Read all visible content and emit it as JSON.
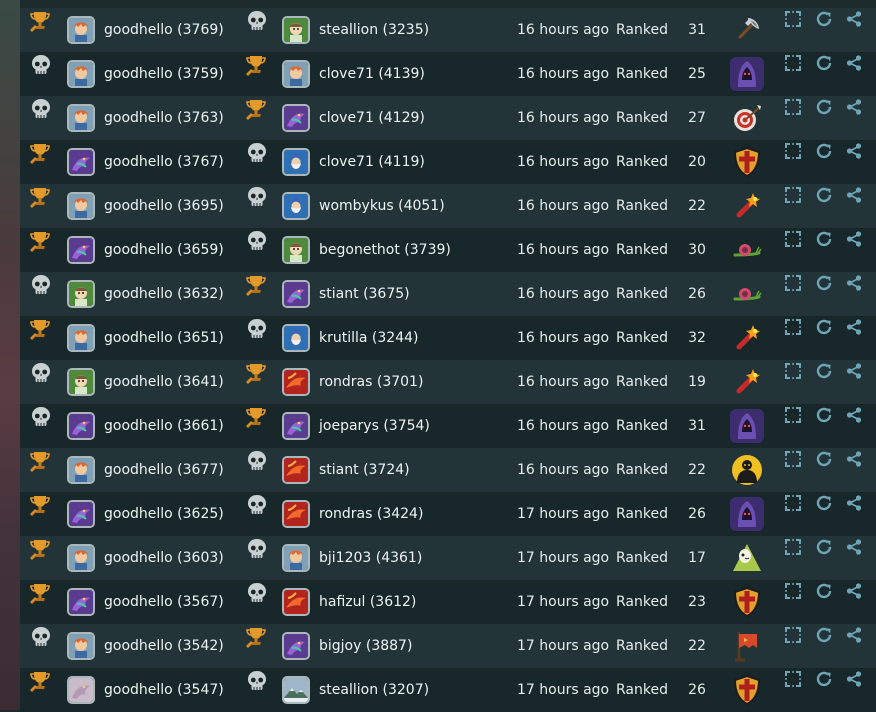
{
  "colors": {
    "row_odd": "#223437",
    "row_even": "#182729",
    "text": "#e6ecec",
    "trophy": "#e39a2a",
    "skull": "#c9d0d1",
    "action_icon": "#6ea6b8"
  },
  "games": [
    {
      "p1_result": "win",
      "p1_avatar": "orange-hair-portrait",
      "p1_name": "goodhello (3769)",
      "p2_result": "loss",
      "p2_avatar": "green-creature-portrait",
      "p2_name": "steallion (3235)",
      "time": "16 hours ago",
      "mode": "Ranked",
      "turns": "31",
      "hero_icon": "axe-icon"
    },
    {
      "p1_result": "loss",
      "p1_avatar": "orange-hair-portrait",
      "p1_name": "goodhello (3759)",
      "p2_result": "win",
      "p2_avatar": "orange-hair-portrait",
      "p2_name": "clove71 (4139)",
      "time": "16 hours ago",
      "mode": "Ranked",
      "turns": "25",
      "hero_icon": "hooded-figure-icon"
    },
    {
      "p1_result": "loss",
      "p1_avatar": "orange-hair-portrait",
      "p1_name": "goodhello (3763)",
      "p2_result": "win",
      "p2_avatar": "purple-dragon-portrait",
      "p2_name": "clove71 (4129)",
      "time": "16 hours ago",
      "mode": "Ranked",
      "turns": "27",
      "hero_icon": "target-icon"
    },
    {
      "p1_result": "win",
      "p1_avatar": "purple-dragon-portrait",
      "p1_name": "goodhello (3767)",
      "p2_result": "loss",
      "p2_avatar": "white-beard-portrait",
      "p2_name": "clove71 (4119)",
      "time": "16 hours ago",
      "mode": "Ranked",
      "turns": "20",
      "hero_icon": "shield-icon"
    },
    {
      "p1_result": "win",
      "p1_avatar": "orange-hair-portrait",
      "p1_name": "goodhello (3695)",
      "p2_result": "loss",
      "p2_avatar": "white-beard-portrait",
      "p2_name": "wombykus (4051)",
      "time": "16 hours ago",
      "mode": "Ranked",
      "turns": "22",
      "hero_icon": "dynamite-icon"
    },
    {
      "p1_result": "win",
      "p1_avatar": "purple-dragon-portrait",
      "p1_name": "goodhello (3659)",
      "p2_result": "loss",
      "p2_avatar": "green-creature-portrait",
      "p2_name": "begonethot (3739)",
      "time": "16 hours ago",
      "mode": "Ranked",
      "turns": "30",
      "hero_icon": "snail-icon"
    },
    {
      "p1_result": "loss",
      "p1_avatar": "green-creature-portrait",
      "p1_name": "goodhello (3632)",
      "p2_result": "win",
      "p2_avatar": "purple-dragon-portrait",
      "p2_name": "stiant (3675)",
      "time": "16 hours ago",
      "mode": "Ranked",
      "turns": "26",
      "hero_icon": "snail-icon"
    },
    {
      "p1_result": "win",
      "p1_avatar": "orange-hair-portrait",
      "p1_name": "goodhello (3651)",
      "p2_result": "loss",
      "p2_avatar": "white-beard-portrait",
      "p2_name": "krutilla (3244)",
      "time": "16 hours ago",
      "mode": "Ranked",
      "turns": "32",
      "hero_icon": "dynamite-icon"
    },
    {
      "p1_result": "loss",
      "p1_avatar": "green-creature-portrait",
      "p1_name": "goodhello (3641)",
      "p2_result": "win",
      "p2_avatar": "red-dragon-portrait",
      "p2_name": "rondras (3701)",
      "time": "16 hours ago",
      "mode": "Ranked",
      "turns": "19",
      "hero_icon": "dynamite-icon"
    },
    {
      "p1_result": "loss",
      "p1_avatar": "purple-dragon-portrait",
      "p1_name": "goodhello (3661)",
      "p2_result": "win",
      "p2_avatar": "purple-dragon-portrait",
      "p2_name": "joeparys (3754)",
      "time": "16 hours ago",
      "mode": "Ranked",
      "turns": "31",
      "hero_icon": "hooded-figure-icon"
    },
    {
      "p1_result": "win",
      "p1_avatar": "orange-hair-portrait",
      "p1_name": "goodhello (3677)",
      "p2_result": "loss",
      "p2_avatar": "red-dragon-portrait",
      "p2_name": "stiant (3724)",
      "time": "16 hours ago",
      "mode": "Ranked",
      "turns": "22",
      "hero_icon": "shadow-figure-icon"
    },
    {
      "p1_result": "win",
      "p1_avatar": "purple-dragon-portrait",
      "p1_name": "goodhello (3625)",
      "p2_result": "loss",
      "p2_avatar": "red-dragon-portrait",
      "p2_name": "rondras (3424)",
      "time": "17 hours ago",
      "mode": "Ranked",
      "turns": "26",
      "hero_icon": "hooded-figure-icon"
    },
    {
      "p1_result": "win",
      "p1_avatar": "orange-hair-portrait",
      "p1_name": "goodhello (3603)",
      "p2_result": "loss",
      "p2_avatar": "orange-hair-portrait",
      "p2_name": "bji1203 (4361)",
      "time": "17 hours ago",
      "mode": "Ranked",
      "turns": "17",
      "hero_icon": "ghost-icon"
    },
    {
      "p1_result": "win",
      "p1_avatar": "purple-dragon-portrait",
      "p1_name": "goodhello (3567)",
      "p2_result": "loss",
      "p2_avatar": "red-dragon-portrait",
      "p2_name": "hafizul (3612)",
      "time": "17 hours ago",
      "mode": "Ranked",
      "turns": "23",
      "hero_icon": "shield-icon"
    },
    {
      "p1_result": "loss",
      "p1_avatar": "orange-hair-portrait",
      "p1_name": "goodhello (3542)",
      "p2_result": "win",
      "p2_avatar": "purple-dragon-portrait",
      "p2_name": "bigjoy (3887)",
      "time": "17 hours ago",
      "mode": "Ranked",
      "turns": "22",
      "hero_icon": "banner-icon"
    },
    {
      "p1_result": "win",
      "p1_avatar": "faded-dragon-portrait",
      "p1_name": "goodhello (3547)",
      "p2_result": "loss",
      "p2_avatar": "snowy-mountain-portrait",
      "p2_name": "steallion (3207)",
      "time": "17 hours ago",
      "mode": "Ranked",
      "turns": "26",
      "hero_icon": "shield-icon"
    }
  ],
  "actions": [
    "expand-icon",
    "replay-icon",
    "share-icon"
  ]
}
